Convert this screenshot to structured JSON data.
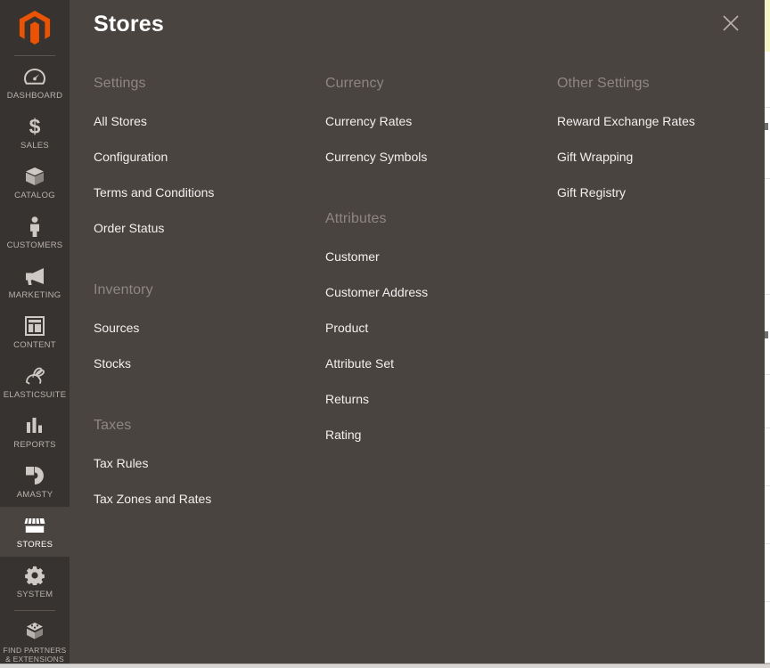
{
  "sidebar": {
    "logo_name": "magento-logo",
    "items": [
      {
        "label": "DASHBOARD",
        "icon": "dashboard-icon",
        "active": false
      },
      {
        "label": "SALES",
        "icon": "dollar-icon",
        "active": false
      },
      {
        "label": "CATALOG",
        "icon": "box-icon",
        "active": false
      },
      {
        "label": "CUSTOMERS",
        "icon": "person-icon",
        "active": false
      },
      {
        "label": "MARKETING",
        "icon": "megaphone-icon",
        "active": false
      },
      {
        "label": "CONTENT",
        "icon": "layout-icon",
        "active": false
      },
      {
        "label": "ELASTICSUITE",
        "icon": "rabbit-icon",
        "active": false
      },
      {
        "label": "REPORTS",
        "icon": "bar-chart-icon",
        "active": false
      },
      {
        "label": "AMASTY",
        "icon": "amasty-icon",
        "active": false
      },
      {
        "label": "STORES",
        "icon": "storefront-icon",
        "active": true
      },
      {
        "label": "SYSTEM",
        "icon": "gear-icon",
        "active": false
      },
      {
        "label": "FIND PARTNERS\n& EXTENSIONS",
        "icon": "extension-icon",
        "active": false
      }
    ]
  },
  "panel": {
    "title": "Stores",
    "close_label": "Close",
    "columns": [
      {
        "groups": [
          {
            "title": "Settings",
            "items": [
              "All Stores",
              "Configuration",
              "Terms and Conditions",
              "Order Status"
            ]
          },
          {
            "title": "Inventory",
            "items": [
              "Sources",
              "Stocks"
            ]
          },
          {
            "title": "Taxes",
            "items": [
              "Tax Rules",
              "Tax Zones and Rates"
            ]
          }
        ]
      },
      {
        "groups": [
          {
            "title": "Currency",
            "items": [
              "Currency Rates",
              "Currency Symbols"
            ]
          },
          {
            "title": "Attributes",
            "items": [
              "Customer",
              "Customer Address",
              "Product",
              "Attribute Set",
              "Returns",
              "Rating"
            ]
          }
        ]
      },
      {
        "groups": [
          {
            "title": "Other Settings",
            "items": [
              "Reward Exchange Rates",
              "Gift Wrapping",
              "Gift Registry"
            ]
          }
        ]
      }
    ]
  },
  "colors": {
    "sidebar_bg": "#373330",
    "panel_bg": "#4a4441",
    "accent_orange": "#eb5202",
    "group_title": "#8d8682",
    "link_text": "#f2efed",
    "underlay_highlight": "#f6f6c9"
  }
}
